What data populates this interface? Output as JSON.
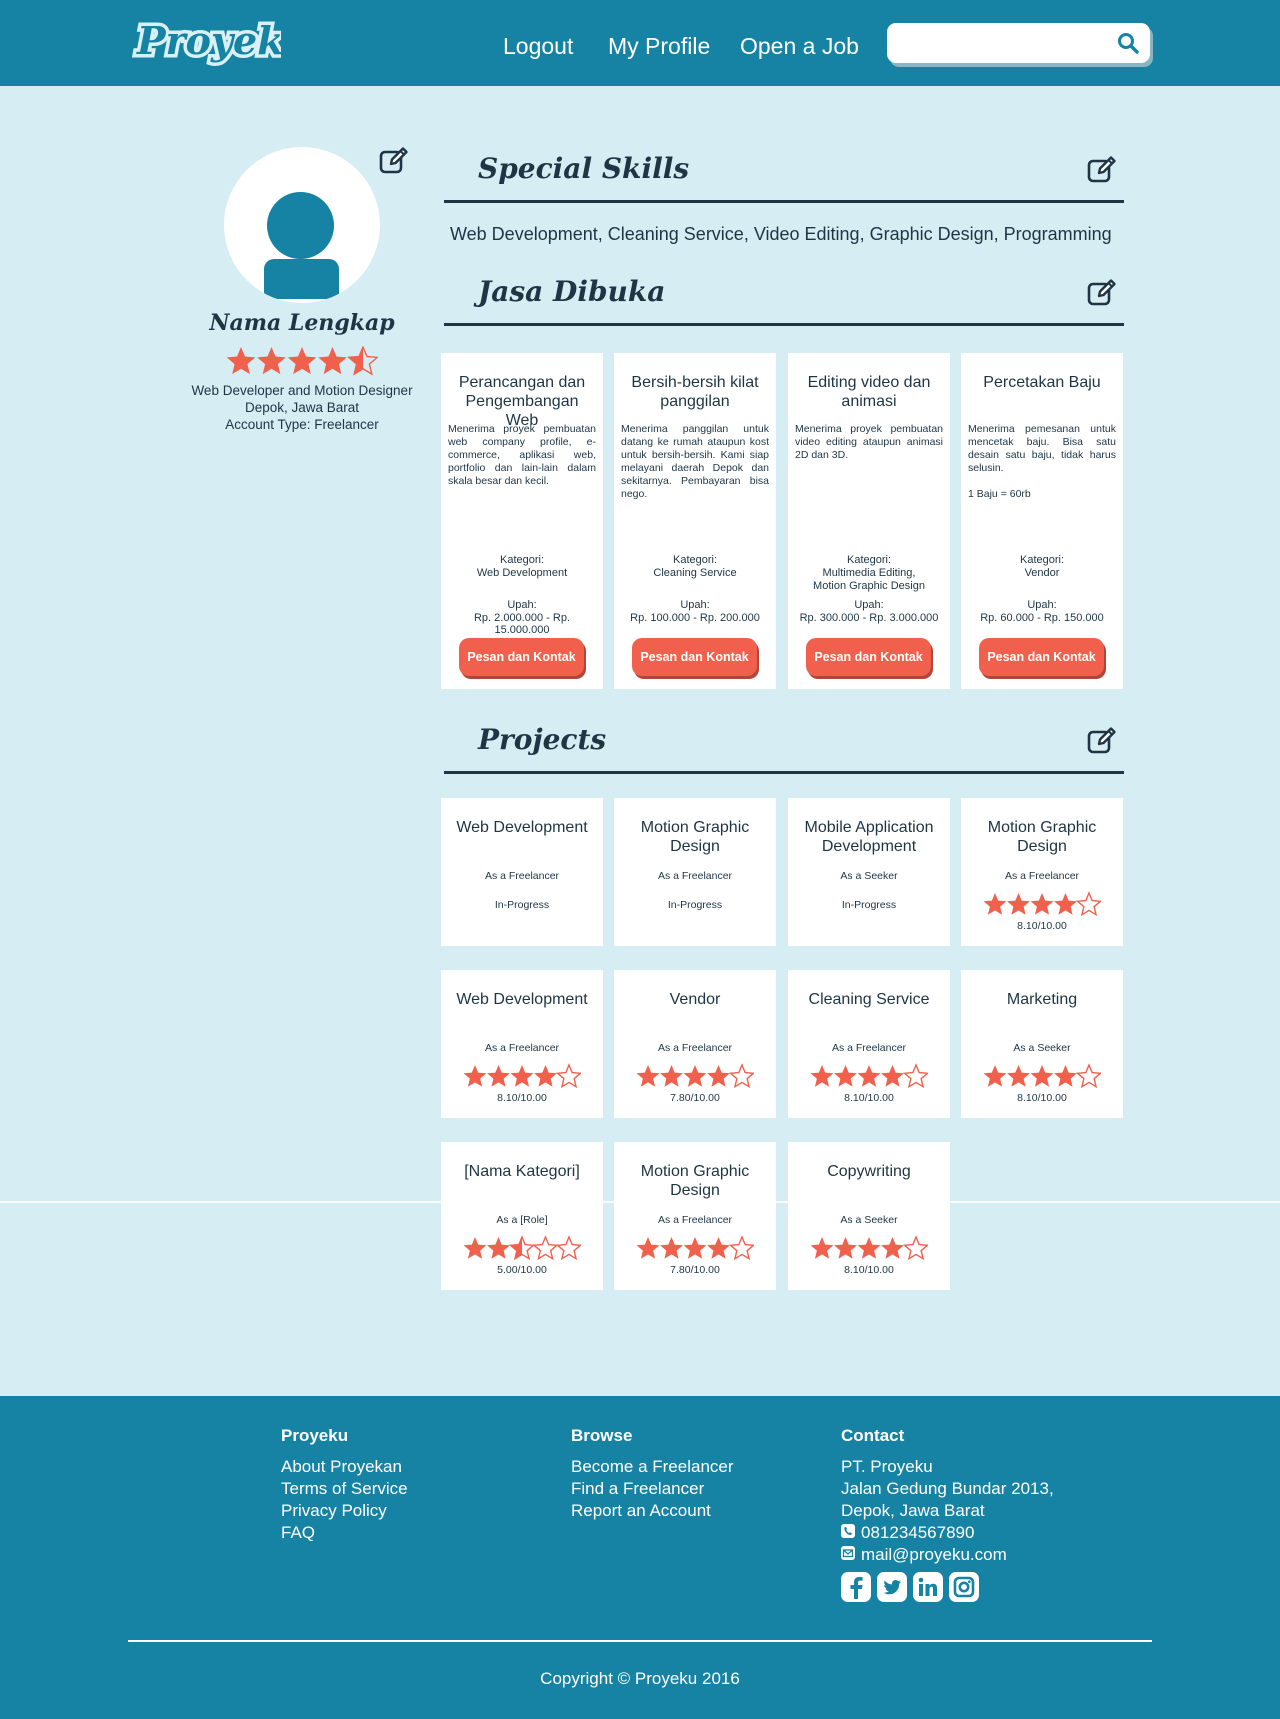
{
  "header": {
    "logo": "Proyeku",
    "nav": [
      "Logout",
      "My Profile",
      "Open a Job"
    ],
    "search_placeholder": ""
  },
  "profile": {
    "name": "Nama Lengkap",
    "rating": 4.5,
    "occupation": "Web Developer and Motion Designer",
    "location": "Depok, Jawa Barat",
    "account_type": "Account Type: Freelancer"
  },
  "skills": {
    "title": "Special Skills",
    "text": "Web Development, Cleaning Service, Video Editing, Graphic Design, Programming"
  },
  "services": {
    "title": "Jasa Dibuka",
    "category_label": "Kategori:",
    "wage_label": "Upah:",
    "button_label": "Pesan dan Kontak",
    "items": [
      {
        "title": "Perancangan dan Pengembangan Web",
        "description": "Menerima proyek pembuatan web company profile, e-commerce, aplikasi web, portfolio dan lain-lain dalam skala besar dan kecil.",
        "category": "Web Development",
        "wage": "Rp. 2.000.000 - Rp. 15.000.000"
      },
      {
        "title": "Bersih-bersih kilat panggilan",
        "description": "Menerima panggilan untuk datang ke rumah ataupun kost untuk bersih-bersih. Kami siap melayani daerah Depok dan sekitarnya. Pembayaran bisa nego.",
        "category": "Cleaning Service",
        "wage": "Rp. 100.000 - Rp. 200.000"
      },
      {
        "title": "Editing video dan animasi",
        "description": "Menerima proyek pembuatan video editing ataupun animasi 2D dan 3D.",
        "category": "Multimedia Editing,\nMotion Graphic Design",
        "wage": "Rp. 300.000 - Rp. 3.000.000"
      },
      {
        "title": "Percetakan Baju",
        "description": "Menerima pemesanan untuk mencetak baju. Bisa satu desain satu baju, tidak harus selusin.\n\n1 Baju = 60rb",
        "category": "Vendor",
        "wage": "Rp. 60.000 - Rp. 150.000"
      }
    ]
  },
  "projects": {
    "title": "Projects",
    "items": [
      {
        "title": "Web Development",
        "role": "As a Freelancer",
        "status": "In-Progress",
        "rating": null,
        "score": ""
      },
      {
        "title": "Motion Graphic Design",
        "role": "As a Freelancer",
        "status": "In-Progress",
        "rating": null,
        "score": ""
      },
      {
        "title": "Mobile Application Development",
        "role": "As a Seeker",
        "status": "In-Progress",
        "rating": null,
        "score": ""
      },
      {
        "title": "Motion Graphic Design",
        "role": "As a Freelancer",
        "status": "",
        "rating": 4,
        "score": "8.10/10.00"
      },
      {
        "title": "Web Development",
        "role": "As a Freelancer",
        "status": "",
        "rating": 4,
        "score": "8.10/10.00"
      },
      {
        "title": "Vendor",
        "role": "As a Freelancer",
        "status": "",
        "rating": 4,
        "score": "7.80/10.00"
      },
      {
        "title": "Cleaning Service",
        "role": "As a Freelancer",
        "status": "",
        "rating": 4,
        "score": "8.10/10.00"
      },
      {
        "title": "Marketing",
        "role": "As a Seeker",
        "status": "",
        "rating": 4,
        "score": "8.10/10.00"
      },
      {
        "title": "[Nama Kategori]",
        "role": "As a [Role]",
        "status": "",
        "rating": 2.5,
        "score": "5.00/10.00"
      },
      {
        "title": "Motion Graphic Design",
        "role": "As a Freelancer",
        "status": "",
        "rating": 4,
        "score": "7.80/10.00"
      },
      {
        "title": "Copywriting",
        "role": "As a Seeker",
        "status": "",
        "rating": 4,
        "score": "8.10/10.00"
      }
    ]
  },
  "footer": {
    "columns": [
      {
        "heading": "Proyeku",
        "links": [
          "About Proyekan",
          "Terms of Service",
          "Privacy Policy",
          "FAQ"
        ]
      },
      {
        "heading": "Browse",
        "links": [
          "Become a Freelancer",
          "Find a Freelancer",
          "Report an Account"
        ]
      }
    ],
    "contact": {
      "heading": "Contact",
      "lines": [
        "PT. Proyeku",
        "Jalan Gedung Bundar 2013,",
        "Depok, Jawa Barat"
      ],
      "phone": "081234567890",
      "email": "mail@proyeku.com",
      "social": [
        "facebook-icon",
        "twitter-icon",
        "linkedin-icon",
        "instagram-icon"
      ]
    },
    "copyright": "Copyright © Proyeku 2016"
  },
  "colors": {
    "primary": "#1683a4",
    "background": "#d5edf3",
    "accent": "#f0604d",
    "text": "#1f3544",
    "card": "#ffffff"
  }
}
